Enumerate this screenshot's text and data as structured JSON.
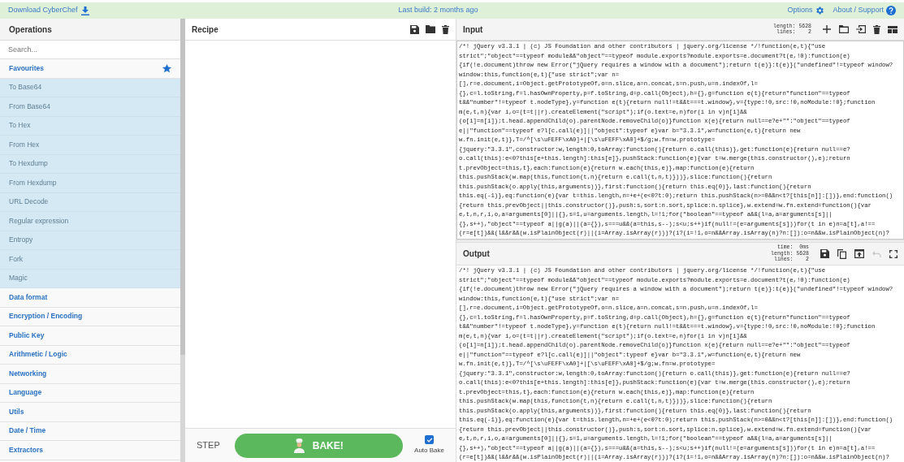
{
  "top_bar": {
    "download_link": "Download CyberChef",
    "last_build": "Last build: 2 months ago",
    "options_link": "Options",
    "about_link": "About / Support"
  },
  "operations": {
    "title": "Operations",
    "search": {
      "placeholder": "Search..."
    },
    "categories": [
      {
        "label": "Favourites",
        "expanded": true,
        "items": [
          "To Base64",
          "From Base64",
          "To Hex",
          "From Hex",
          "To Hexdump",
          "From Hexdump",
          "URL Decode",
          "Regular expression",
          "Entropy",
          "Fork",
          "Magic"
        ]
      },
      {
        "label": "Data format",
        "expanded": false
      },
      {
        "label": "Encryption / Encoding",
        "expanded": false
      },
      {
        "label": "Public Key",
        "expanded": false
      },
      {
        "label": "Arithmetic / Logic",
        "expanded": false
      },
      {
        "label": "Networking",
        "expanded": false
      },
      {
        "label": "Language",
        "expanded": false
      },
      {
        "label": "Utils",
        "expanded": false
      },
      {
        "label": "Date / Time",
        "expanded": false
      },
      {
        "label": "Extractors",
        "expanded": false
      }
    ]
  },
  "recipe": {
    "title": "Recipe",
    "step_button": "STEP",
    "bake_button": "BAKE!",
    "auto_bake": {
      "label": "Auto Bake",
      "checked": true
    }
  },
  "input": {
    "title": "Input",
    "stats": [
      {
        "label": "length:",
        "value": "5628"
      },
      {
        "label": "lines:",
        "value": "2"
      }
    ],
    "lines": [
      "/*! jQuery v3.3.1 | (c) JS Foundation and other contributors | jquery.org/license */!function(e,t){\"use",
      "strict\";\"object\"==typeof module&&\"object\"==typeof module.exports?module.exports=e.document?t(e,!0):function(e)",
      "{if(!e.document)throw new Error(\"jQuery requires a window with a document\");return t(e)}:t(e)}(\"undefined\"!=typeof window?",
      "window:this,function(e,t){\"use strict\";var n=",
      "[],r=e.document,i=Object.getPrototypeOf,o=n.slice,a=n.concat,s=n.push,u=n.indexOf,l=",
      "{},c=l.toString,f=l.hasOwnProperty,p=f.toString,d=p.call(Object),h={},g=function e(t){return\"function\"==typeof",
      "t&&\"number\"!=typeof t.nodeType},y=function e(t){return null!=t&&t===t.window},v={type:!0,src:!0,noModule:!0};function",
      "m(e,t,n){var i,o=(t=t||r).createElement(\"script\");if(o.text=e,n)for(i in v)n[i]&&",
      "(o[i]=n[i]);t.head.appendChild(o).parentNode.removeChild(o)}function x(e){return null==e?e+\"\":\"object\"==typeof",
      "e||\"function\"==typeof e?l[c.call(e)]||\"object\":typeof e}var b=\"3.3.1\",w=function(e,t){return new",
      "w.fn.init(e,t)},T=/^[\\s\\uFEFF\\xA0]+|[\\s\\uFEFF\\xA0]+$/g;w.fn=w.prototype=",
      "{jquery:\"3.3.1\",constructor:w,length:0,toArray:function(){return o.call(this)},get:function(e){return null==e?",
      "o.call(this):e<0?this[e+this.length]:this[e]},pushStack:function(e){var t=w.merge(this.constructor(),e);return",
      "t.prevObject=this,t},each:function(e){return w.each(this,e)},map:function(e){return",
      "this.pushStack(w.map(this,function(t,n){return e.call(t,n,t)}))},slice:function(){return",
      "this.pushStack(o.apply(this,arguments))},first:function(){return this.eq(0)},last:function(){return",
      "this.eq(-1)},eq:function(e){var t=this.length,n=+e+(e<0?t:0);return this.pushStack(n>=0&&n<t?[this[n]]:[])},end:function()",
      "{return this.prevObject||this.constructor()},push:s,sort:n.sort,splice:n.splice},w.extend=w.fn.extend=function(){var",
      "e,t,n,r,i,o,a=arguments[0]||{},s=1,u=arguments.length,l=!1;for(\"boolean\"==typeof a&&(l=a,a=arguments[s]||",
      "{},s++),\"object\"==typeof a||g(a)||(a={}),s===u&&(a=this,s--);s<u;s++)if(null!=(e=arguments[s]))for(t in e)n=a[t],a!==",
      "(r=e[t])&&(l&&r&&(w.isPlainObject(r)||(i=Array.isArray(r)))?(i?(i=!1,o=n&&Array.isArray(n)?n:[]):o=n&&w.isPlainObject(n)?"
    ]
  },
  "output": {
    "title": "Output",
    "stats": [
      {
        "label": "time:",
        "value": "0ms"
      },
      {
        "label": "length:",
        "value": "5628"
      },
      {
        "label": "lines:",
        "value": "2"
      }
    ],
    "undo_disabled": true,
    "lines": [
      "/*! jQuery v3.3.1 | (c) JS Foundation and other contributors | jquery.org/license */!function(e,t){\"use",
      "strict\";\"object\"==typeof module&&\"object\"==typeof module.exports?module.exports=e.document?t(e,!0):function(e)",
      "{if(!e.document)throw new Error(\"jQuery requires a window with a document\");return t(e)}:t(e)}(\"undefined\"!=typeof window?",
      "window:this,function(e,t){\"use strict\";var n=",
      "[],r=e.document,i=Object.getPrototypeOf,o=n.slice,a=n.concat,s=n.push,u=n.indexOf,l=",
      "{},c=l.toString,f=l.hasOwnProperty,p=f.toString,d=p.call(Object),h={},g=function e(t){return\"function\"==typeof",
      "t&&\"number\"!=typeof t.nodeType},y=function e(t){return null!=t&&t===t.window},v={type:!0,src:!0,noModule:!0};function",
      "m(e,t,n){var i,o=(t=t||r).createElement(\"script\");if(o.text=e,n)for(i in v)n[i]&&",
      "(o[i]=n[i]);t.head.appendChild(o).parentNode.removeChild(o)}function x(e){return null==e?e+\"\":\"object\"==typeof",
      "e||\"function\"==typeof e?l[c.call(e)]||\"object\":typeof e}var b=\"3.3.1\",w=function(e,t){return new",
      "w.fn.init(e,t)},T=/^[\\s\\uFEFF\\xA0]+|[\\s\\uFEFF\\xA0]+$/g;w.fn=w.prototype=",
      "{jquery:\"3.3.1\",constructor:w,length:0,toArray:function(){return o.call(this)},get:function(e){return null==e?",
      "o.call(this):e<0?this[e+this.length]:this[e]},pushStack:function(e){var t=w.merge(this.constructor(),e);return",
      "t.prevObject=this,t},each:function(e){return w.each(this,e)},map:function(e){return",
      "this.pushStack(w.map(this,function(t,n){return e.call(t,n,t)}))},slice:function(){return",
      "this.pushStack(o.apply(this,arguments))},first:function(){return this.eq(0)},last:function(){return",
      "this.eq(-1)},eq:function(e){var t=this.length,n=+e+(e<0?t:0);return this.pushStack(n>=0&&n<t?[this[n]]:[])},end:function()",
      "{return this.prevObject||this.constructor()},push:s,sort:n.sort,splice:n.splice},w.extend=w.fn.extend=function(){var",
      "e,t,n,r,i,o,a=arguments[0]||{},s=1,u=arguments.length,l=!1;for(\"boolean\"==typeof a&&(l=a,a=arguments[s]||",
      "{},s++),\"object\"==typeof a||g(a)||(a={}),s===u&&(a=this,s--);s<u;s++)if(null!=(e=arguments[s]))for(t in e)n=a[t],a!==",
      "(r=e[t])&&(l&&r&&(w.isPlainObject(r)||(i=Array.isArray(r)))?(i?(i=!1,o=n&&Array.isArray(n)?n:[]):o=n&&w.isPlainObject(n)?"
    ]
  }
}
